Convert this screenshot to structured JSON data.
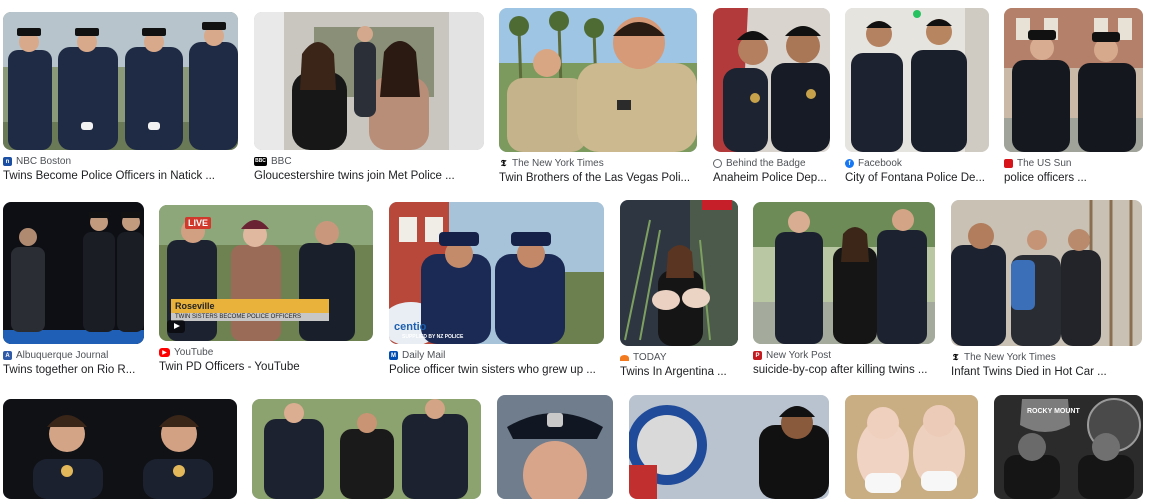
{
  "rows": [
    [
      {
        "source": "NBC Boston",
        "title": "Twins Become Police Officers in Natick ...",
        "favicon": "nbc-boston-icon",
        "color": "#1a4fa3"
      },
      {
        "source": "BBC",
        "title": "Gloucestershire twins join Met Police ...",
        "favicon": "bbc-icon",
        "color": "#000000"
      },
      {
        "source": "The New York Times",
        "title": "Twin Brothers of the Las Vegas Poli...",
        "favicon": "nyt-icon",
        "color": "#000000"
      },
      {
        "source": "Behind the Badge",
        "title": "Anaheim Police Dep...",
        "favicon": "globe-icon",
        "color": "#5f6368"
      },
      {
        "source": "Facebook",
        "title": "City of Fontana Police De...",
        "favicon": "facebook-icon",
        "color": "#1877f2"
      },
      {
        "source": "The US Sun",
        "title": "police officers ...",
        "favicon": "us-sun-icon",
        "color": "#d7141a"
      }
    ],
    [
      {
        "source": "Albuquerque Journal",
        "title": "Twins together on Rio R...",
        "favicon": "albuquerque-journal-icon",
        "color": "#2e5aa8"
      },
      {
        "source": "YouTube",
        "title": "Twin PD Officers - YouTube",
        "favicon": "youtube-icon",
        "color": "#ff0000"
      },
      {
        "source": "Daily Mail",
        "title": "Police officer twin sisters who grew up ...",
        "favicon": "daily-mail-icon",
        "color": "#004db3"
      },
      {
        "source": "TODAY",
        "title": "Twins In Argentina ...",
        "favicon": "today-icon",
        "color": "#f47a20"
      },
      {
        "source": "New York Post",
        "title": "suicide-by-cop after killing twins ...",
        "favicon": "ny-post-icon",
        "color": "#c41a1f"
      },
      {
        "source": "The New York Times",
        "title": "Infant Twins Died in Hot Car ...",
        "favicon": "nyt-icon",
        "color": "#000000"
      }
    ]
  ],
  "overlays": {
    "live": "LIVE",
    "roseville": "Roseville",
    "roseville_sub": "TWIN SISTERS BECOME POLICE OFFICERS",
    "daily_mail_watermark": "SUPPLIED BY NZ POLICE",
    "centenary": "centio",
    "rocky_mount": "ROCKY MOUNT"
  }
}
